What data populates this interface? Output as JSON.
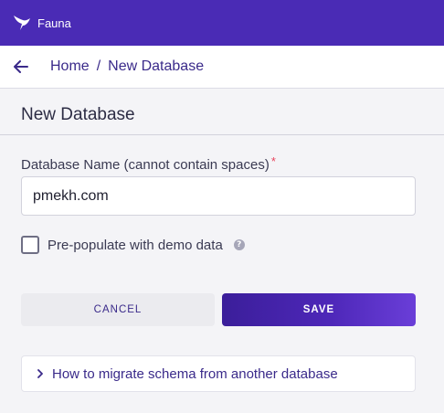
{
  "app": {
    "name": "Fauna",
    "logo_icon": "fauna-bird-logo-icon",
    "brand_color": "#4a2bb5"
  },
  "breadcrumb": {
    "back_icon": "arrow-left-icon",
    "items": [
      {
        "label": "Home"
      },
      {
        "label": "New Database"
      }
    ],
    "separator": "/"
  },
  "page": {
    "title": "New Database"
  },
  "form": {
    "name_label": "Database Name (cannot contain spaces)",
    "required_mark": "*",
    "name_value": "pmekh.com",
    "demo_checkbox": {
      "label": "Pre-populate with demo data",
      "checked": false,
      "help_icon": "question-circle-icon",
      "help_glyph": "?"
    },
    "cancel_label": "CANCEL",
    "save_label": "SAVE"
  },
  "migrate": {
    "label": "How to migrate schema from another database",
    "icon": "chevron-right-icon"
  }
}
